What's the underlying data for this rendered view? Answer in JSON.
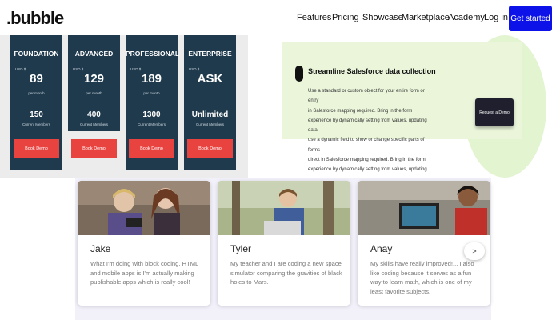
{
  "header": {
    "logo": ".bubble",
    "nav": [
      "Features",
      "Pricing",
      "Showcase",
      "Marketplace",
      "Academy",
      "Log in"
    ],
    "cta": "Get started"
  },
  "pricing": {
    "plans": [
      {
        "name": "FOUNDATION",
        "currency": "USD $",
        "price": "89",
        "period": "per month",
        "users": "150",
        "users_label": "Current Members",
        "button": "Book Demo"
      },
      {
        "name": "ADVANCED",
        "currency": "USD $",
        "price": "129",
        "period": "per month",
        "users": "400",
        "users_label": "Current Members",
        "button": "Book Demo"
      },
      {
        "name": "PROFESSIONAL",
        "currency": "USD $",
        "price": "189",
        "period": "per month",
        "users": "1300",
        "users_label": "Current Members",
        "button": "Book Demo"
      },
      {
        "name": "ENTERPRISE",
        "currency": "USD $",
        "price": "ASK",
        "period": "",
        "users": "Unlimited",
        "users_label": "Current Members",
        "button": "Book Demo"
      }
    ]
  },
  "banner": {
    "title": "Streamline Salesforce data collection",
    "lines": [
      "Use a standard or custom object for your entire form or entry",
      "in Salesforce mapping required. Bring in the form",
      "experience by dynamically setting from values, updating data",
      "use a dynamic field to show or change specific parts of forms",
      "direct in Salesforce mapping required. Bring in the form",
      "experience by dynamically setting from values, updating data"
    ],
    "button": "Request a Demo"
  },
  "testimonials": [
    {
      "name": "Jake",
      "quote": "What I'm doing with block coding, HTML and mobile apps is I'm actually making publishable apps which is really cool!"
    },
    {
      "name": "Tyler",
      "quote": "My teacher and I are coding a new space simulator comparing the gravities of black holes to Mars."
    },
    {
      "name": "Anay",
      "quote": "My skills have really improved!... I also like coding because it serves as a fun way to learn math, which is one of my least favorite subjects."
    }
  ],
  "carousel": {
    "next_label": ">"
  },
  "colors": {
    "brand_blue": "#0d13e8",
    "plan_navy": "#1f3a4d",
    "button_red": "#e8433f",
    "banner_green": "#eaf5da"
  }
}
